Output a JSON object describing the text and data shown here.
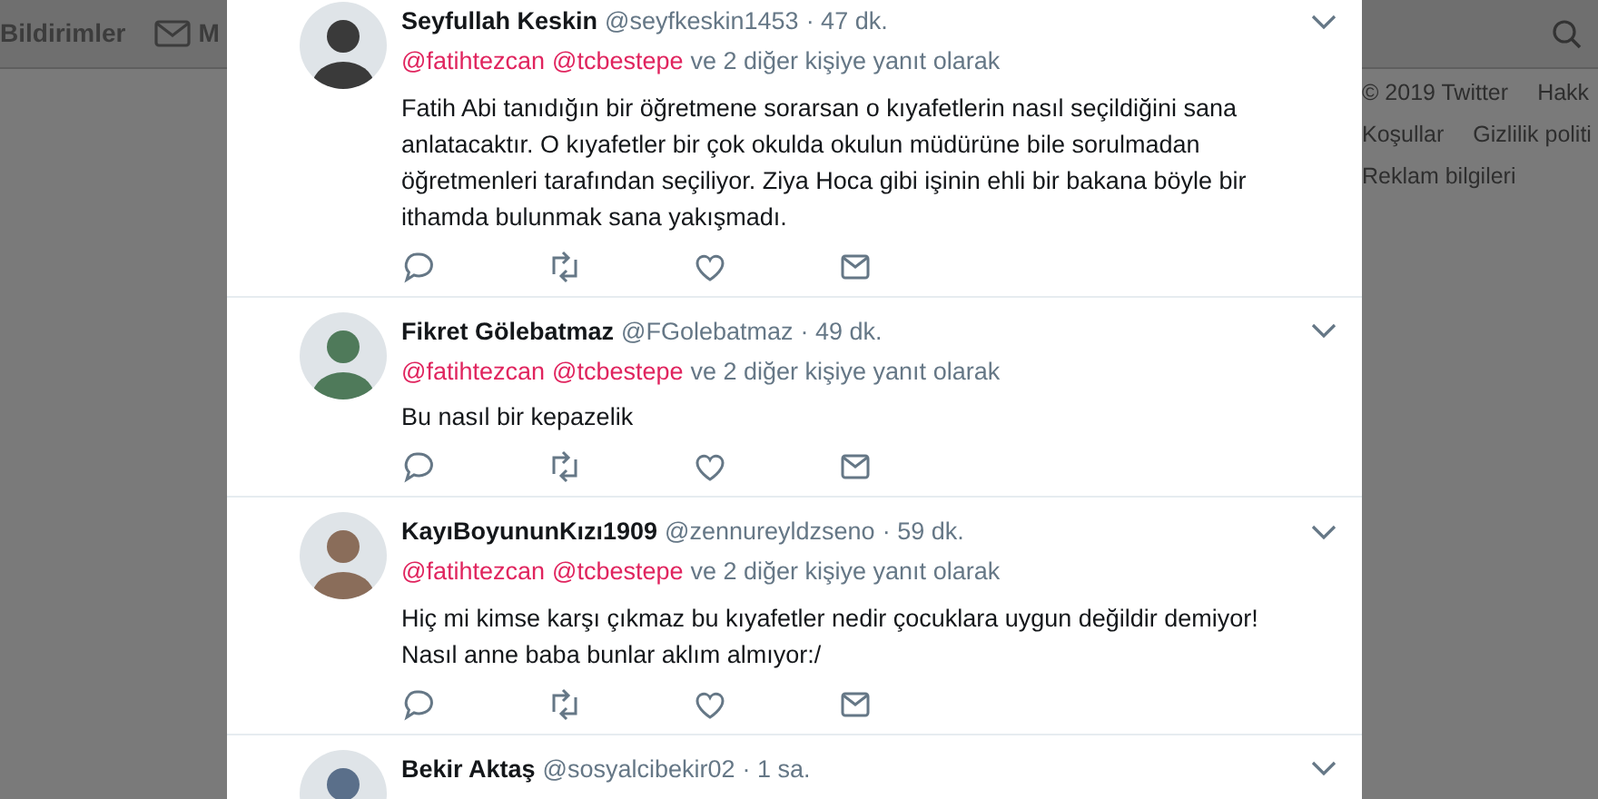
{
  "nav": {
    "tabs": [
      {
        "label": "Bildirimler",
        "kind": "text"
      },
      {
        "label": "M",
        "kind": "mail"
      }
    ]
  },
  "footer": [
    [
      "© 2019 Twitter",
      "Hakk"
    ],
    [
      "Koşullar",
      "Gizlilik politi"
    ],
    [
      "Reklam bilgileri"
    ]
  ],
  "tweets": [
    {
      "name": "Seyfullah Keskin",
      "handle": "@seyfkeskin1453",
      "time": "· 47 dk.",
      "reply_to": [
        "@fatihtezcan",
        "@tcbestepe"
      ],
      "reply_suffix": "ve 2 diğer kişiye yanıt olarak",
      "text": "Fatih Abi tanıdığın bir öğretmene sorarsan o kıyafetlerin nasıl seçildiğini sana anlatacaktır. O kıyafetler bir çok okulda okulun müdürüne bile sorulmadan öğretmenleri tarafından seçiliyor. Ziya Hoca gibi işinin ehli bir bakana böyle bir ithamda bulunmak sana yakışmadı."
    },
    {
      "name": "Fikret Gölebatmaz",
      "handle": "@FGolebatmaz",
      "time": "· 49 dk.",
      "reply_to": [
        "@fatihtezcan",
        "@tcbestepe"
      ],
      "reply_suffix": "ve 2 diğer kişiye yanıt olarak",
      "text": "Bu nasıl bir kepazelik"
    },
    {
      "name": "KayıBoyununKızı1909",
      "handle": "@zennureyldzseno",
      "time": "· 59 dk.",
      "reply_to": [
        "@fatihtezcan",
        "@tcbestepe"
      ],
      "reply_suffix": "ve 2 diğer kişiye yanıt olarak",
      "text": "Hiç mi kimse karşı çıkmaz bu kıyafetler nedir çocuklara uygun değildir demiyor! Nasıl anne baba bunlar aklım almıyor:/"
    },
    {
      "name": "Bekir Aktaş",
      "handle": "@sosyalcibekir02",
      "time": "· 1 sa."
    }
  ]
}
